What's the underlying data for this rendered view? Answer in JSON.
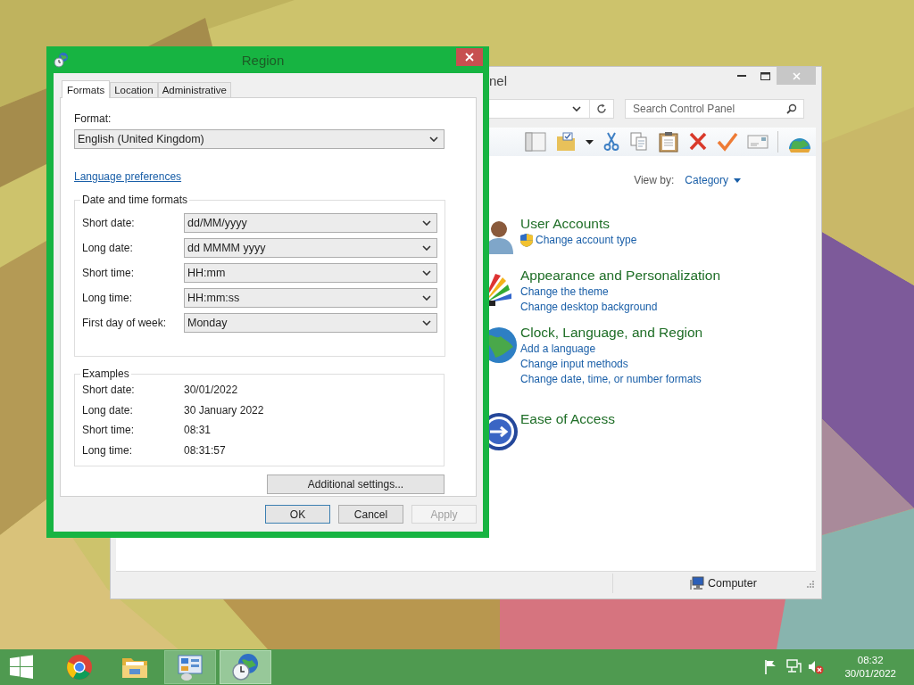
{
  "control_panel": {
    "title": "nel",
    "search": {
      "placeholder": "Search Control Panel"
    },
    "tools": [
      {
        "kind": "layout"
      },
      {
        "kind": "folder"
      },
      {
        "kind": "caret"
      },
      {
        "kind": "scissors"
      },
      {
        "kind": "copy"
      },
      {
        "kind": "paste"
      },
      {
        "kind": "delete"
      },
      {
        "kind": "check"
      },
      {
        "kind": "mail"
      },
      {
        "kind": "separator"
      },
      {
        "kind": "globe"
      }
    ],
    "view_by": {
      "label": "View by:",
      "value": "Category"
    },
    "categories": [
      {
        "kind": "user",
        "title": "User Accounts",
        "links": [
          {
            "text": "Change account type",
            "shield": true
          }
        ]
      },
      {
        "kind": "appearance",
        "title": "Appearance and Personalization",
        "links": [
          {
            "text": "Change the theme",
            "shield": false
          },
          {
            "text": "Change desktop background",
            "shield": false
          }
        ]
      },
      {
        "kind": "globe",
        "title": "Clock, Language, and Region",
        "links": [
          {
            "text": "Add a language",
            "shield": false
          },
          {
            "text": "Change input methods",
            "shield": false
          },
          {
            "text": "Change date, time, or number formats",
            "shield": false
          }
        ]
      },
      {
        "kind": "access",
        "title": "Ease of Access"
      }
    ],
    "status_bar": {
      "location": "Computer"
    }
  },
  "region_dialog": {
    "title": "Region",
    "tabs": [
      {
        "label": "Formats",
        "selected": true
      },
      {
        "label": "Location",
        "selected": false
      },
      {
        "label": "Administrative",
        "selected": false
      }
    ],
    "format_label": "Format:",
    "format_value": "English (United Kingdom)",
    "language_link": "Language preferences",
    "formats_group": {
      "title": "Date and time formats",
      "rows": [
        {
          "label": "Short date:",
          "value": "dd/MM/yyyy"
        },
        {
          "label": "Long date:",
          "value": "dd MMMM yyyy"
        },
        {
          "label": "Short time:",
          "value": "HH:mm"
        },
        {
          "label": "Long time:",
          "value": "HH:mm:ss"
        },
        {
          "label": "First day of week:",
          "value": "Monday"
        }
      ]
    },
    "examples_group": {
      "title": "Examples",
      "rows": [
        {
          "label": "Short date:",
          "value": "30/01/2022"
        },
        {
          "label": "Long date:",
          "value": "30 January 2022"
        },
        {
          "label": "Short time:",
          "value": "08:31"
        },
        {
          "label": "Long time:",
          "value": "08:31:57"
        }
      ]
    },
    "additional_button": "Additional settings...",
    "buttons": [
      {
        "label": "OK",
        "default": true,
        "disabled": false
      },
      {
        "label": "Cancel",
        "default": false,
        "disabled": false
      },
      {
        "label": "Apply",
        "default": false,
        "disabled": true
      }
    ]
  },
  "taskbar": {
    "apps": [
      {
        "kind": "start",
        "open": false,
        "selected": false
      },
      {
        "kind": "browser",
        "open": false,
        "selected": false
      },
      {
        "kind": "folder",
        "open": false,
        "selected": false
      },
      {
        "kind": "control-panel",
        "open": true,
        "selected": false
      },
      {
        "kind": "region",
        "open": true,
        "selected": true
      }
    ],
    "tray": [
      {
        "kind": "flag"
      },
      {
        "kind": "network"
      },
      {
        "kind": "volume-muted"
      }
    ],
    "clock": {
      "time": "08:32",
      "date": "30/01/2022"
    }
  }
}
